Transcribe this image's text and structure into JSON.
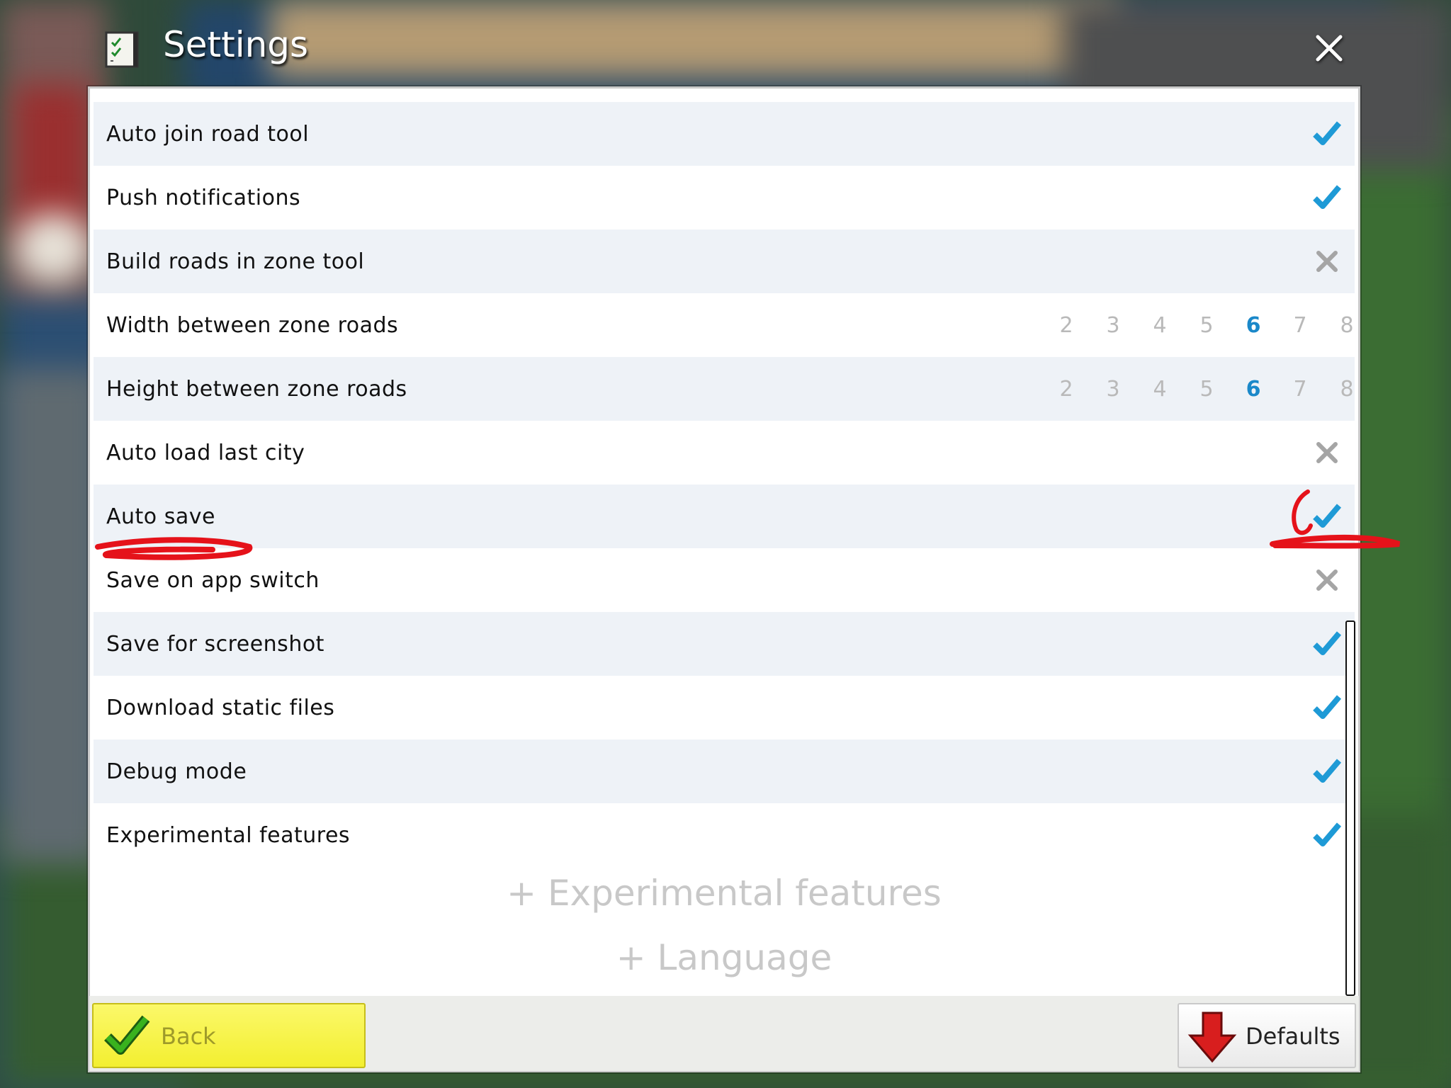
{
  "window": {
    "title": "Settings"
  },
  "settings": [
    {
      "label": "Auto join road tool",
      "state": "check"
    },
    {
      "label": "Push notifications",
      "state": "check"
    },
    {
      "label": "Build roads in zone tool",
      "state": "cross"
    },
    {
      "label": "Width between zone roads",
      "options": [
        "2",
        "3",
        "4",
        "5",
        "6",
        "7",
        "8"
      ],
      "selected": "6"
    },
    {
      "label": "Height between zone roads",
      "options": [
        "2",
        "3",
        "4",
        "5",
        "6",
        "7",
        "8"
      ],
      "selected": "6"
    },
    {
      "label": "Auto load last city",
      "state": "cross"
    },
    {
      "label": "Auto save",
      "state": "check"
    },
    {
      "label": "Save on app switch",
      "state": "cross"
    },
    {
      "label": "Save for screenshot",
      "state": "check"
    },
    {
      "label": "Download static files",
      "state": "check"
    },
    {
      "label": "Debug mode",
      "state": "check"
    },
    {
      "label": "Experimental features",
      "state": "check"
    }
  ],
  "sections": {
    "experimental": "+ Experimental features",
    "language": "+ Language"
  },
  "buttons": {
    "back": "Back",
    "defaults": "Defaults"
  },
  "colors": {
    "check": "#1e9ad6",
    "cross": "#a5a5a5",
    "selected": "#1a88c9",
    "back_button": "#f5f132",
    "annotation": "#e5121a"
  },
  "icons": {
    "title": "checklist-icon",
    "close": "close-icon",
    "back": "green-check-icon",
    "defaults": "red-down-arrow-icon"
  }
}
